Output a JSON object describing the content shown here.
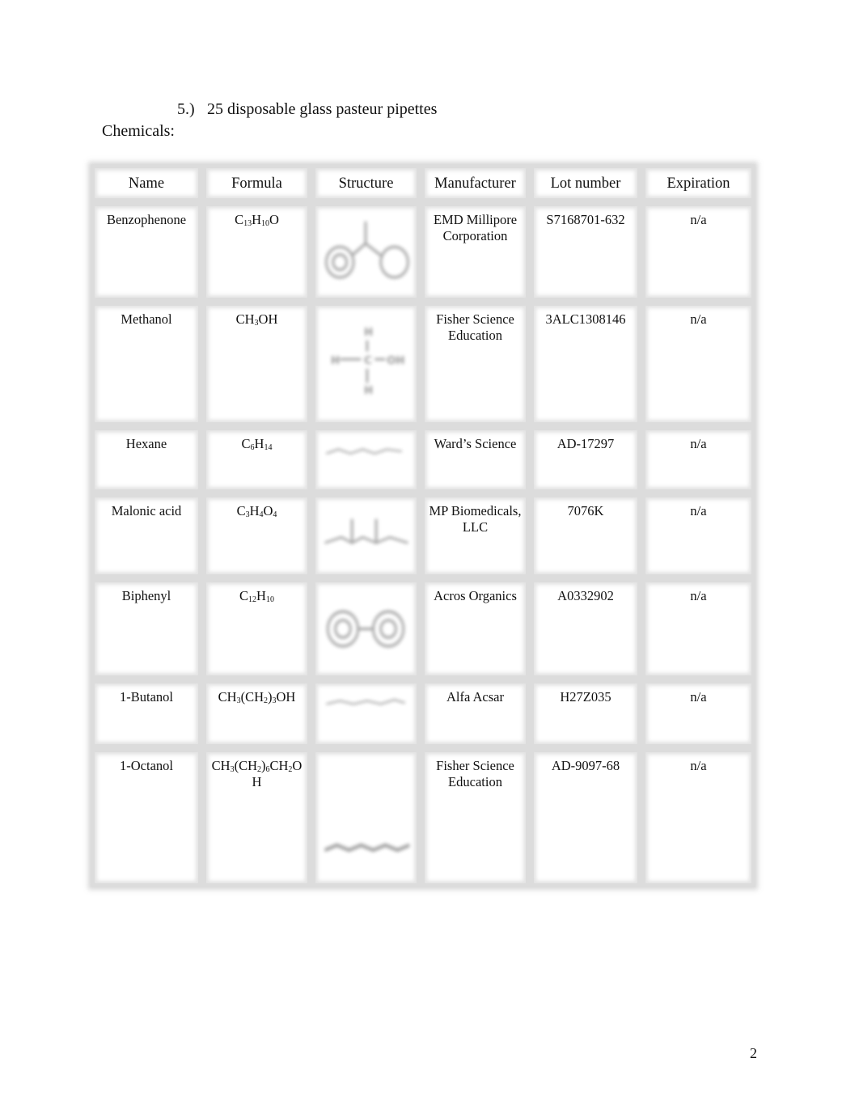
{
  "document": {
    "list_item": {
      "number": "5.)",
      "text": "25 disposable glass pasteur pipettes"
    },
    "section_heading": "Chemicals:",
    "page_number": "2"
  },
  "table": {
    "headers": [
      "Name",
      "Formula",
      "Structure",
      "Manufacturer",
      "Lot number",
      "Expiration"
    ],
    "rows": [
      {
        "name": "Benzophenone",
        "formula": [
          [
            "C",
            ""
          ],
          [
            "13",
            "sub"
          ],
          [
            "H",
            ""
          ],
          [
            "10",
            "sub"
          ],
          [
            "O",
            ""
          ]
        ],
        "formula_text": "C13H10O",
        "structure": "benzophenone-structure",
        "manufacturer": "EMD Millipore Corporation",
        "lot": "S7168701-632",
        "expiration": "n/a"
      },
      {
        "name": "Methanol",
        "formula": [
          [
            "CH",
            ""
          ],
          [
            "3",
            "sub"
          ],
          [
            "OH",
            ""
          ]
        ],
        "formula_text": "CH3OH",
        "structure": "methanol-structure",
        "manufacturer": "Fisher Science Education",
        "lot": "3ALC1308146",
        "expiration": "n/a"
      },
      {
        "name": "Hexane",
        "formula": [
          [
            "C",
            ""
          ],
          [
            "6",
            "sub"
          ],
          [
            "H",
            ""
          ],
          [
            "14",
            "sub"
          ]
        ],
        "formula_text": "C6H14",
        "structure": "hexane-structure",
        "manufacturer": "Ward’s Science",
        "lot": "AD-17297",
        "expiration": "n/a"
      },
      {
        "name": "Malonic acid",
        "formula": [
          [
            "C",
            ""
          ],
          [
            "3",
            "sub"
          ],
          [
            "H",
            ""
          ],
          [
            "4",
            "sub"
          ],
          [
            "O",
            ""
          ],
          [
            "4",
            "sub"
          ]
        ],
        "formula_text": "C3H4O4",
        "structure": "malonic-acid-structure",
        "manufacturer": "MP Biomedicals, LLC",
        "lot": "7076K",
        "expiration": "n/a"
      },
      {
        "name": "Biphenyl",
        "formula": [
          [
            "C",
            ""
          ],
          [
            "12",
            "sub"
          ],
          [
            "H",
            ""
          ],
          [
            "10",
            "sub"
          ]
        ],
        "formula_text": "C12H10",
        "structure": "biphenyl-structure",
        "manufacturer": "Acros Organics",
        "lot": "A0332902",
        "expiration": "n/a"
      },
      {
        "name": "1-Butanol",
        "formula": [
          [
            "CH",
            ""
          ],
          [
            "3",
            "sub"
          ],
          [
            "(CH",
            ""
          ],
          [
            "2",
            "sub"
          ],
          [
            ")",
            ""
          ],
          [
            "3",
            "sub"
          ],
          [
            "OH",
            ""
          ]
        ],
        "formula_text": "CH3(CH2)3OH",
        "structure": "butanol-structure",
        "manufacturer": "Alfa Acsar",
        "lot": "H27Z035",
        "expiration": "n/a"
      },
      {
        "name": "1-Octanol",
        "formula": [
          [
            "CH",
            ""
          ],
          [
            "3",
            "sub"
          ],
          [
            "(CH",
            ""
          ],
          [
            "2",
            "sub"
          ],
          [
            ")",
            ""
          ],
          [
            "6",
            "sub"
          ],
          [
            "CH",
            ""
          ],
          [
            "2",
            "sub"
          ],
          [
            "O H",
            ""
          ]
        ],
        "formula_text": "CH3(CH2)6CH2OH",
        "structure": "octanol-structure",
        "manufacturer": "Fisher Science Education",
        "lot": "AD-9097-68",
        "expiration": "n/a"
      }
    ]
  },
  "structure_labels": {
    "methanol": {
      "top": "H",
      "left": "H",
      "center": "C",
      "right": "OH",
      "bottom": "H"
    }
  }
}
